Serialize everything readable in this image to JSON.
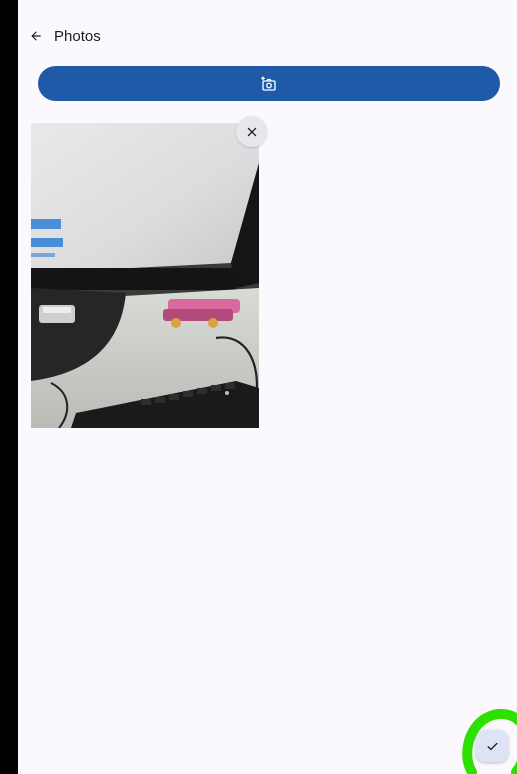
{
  "header": {
    "title": "Photos",
    "back_icon": "arrow-left-icon"
  },
  "actions": {
    "add_photo_icon": "add-photo-camera-icon",
    "remove_icon": "close-icon",
    "confirm_icon": "check-icon"
  },
  "colors": {
    "primary": "#1e5aa8",
    "background": "#fbf9fd",
    "annotation": "#2ee000"
  }
}
